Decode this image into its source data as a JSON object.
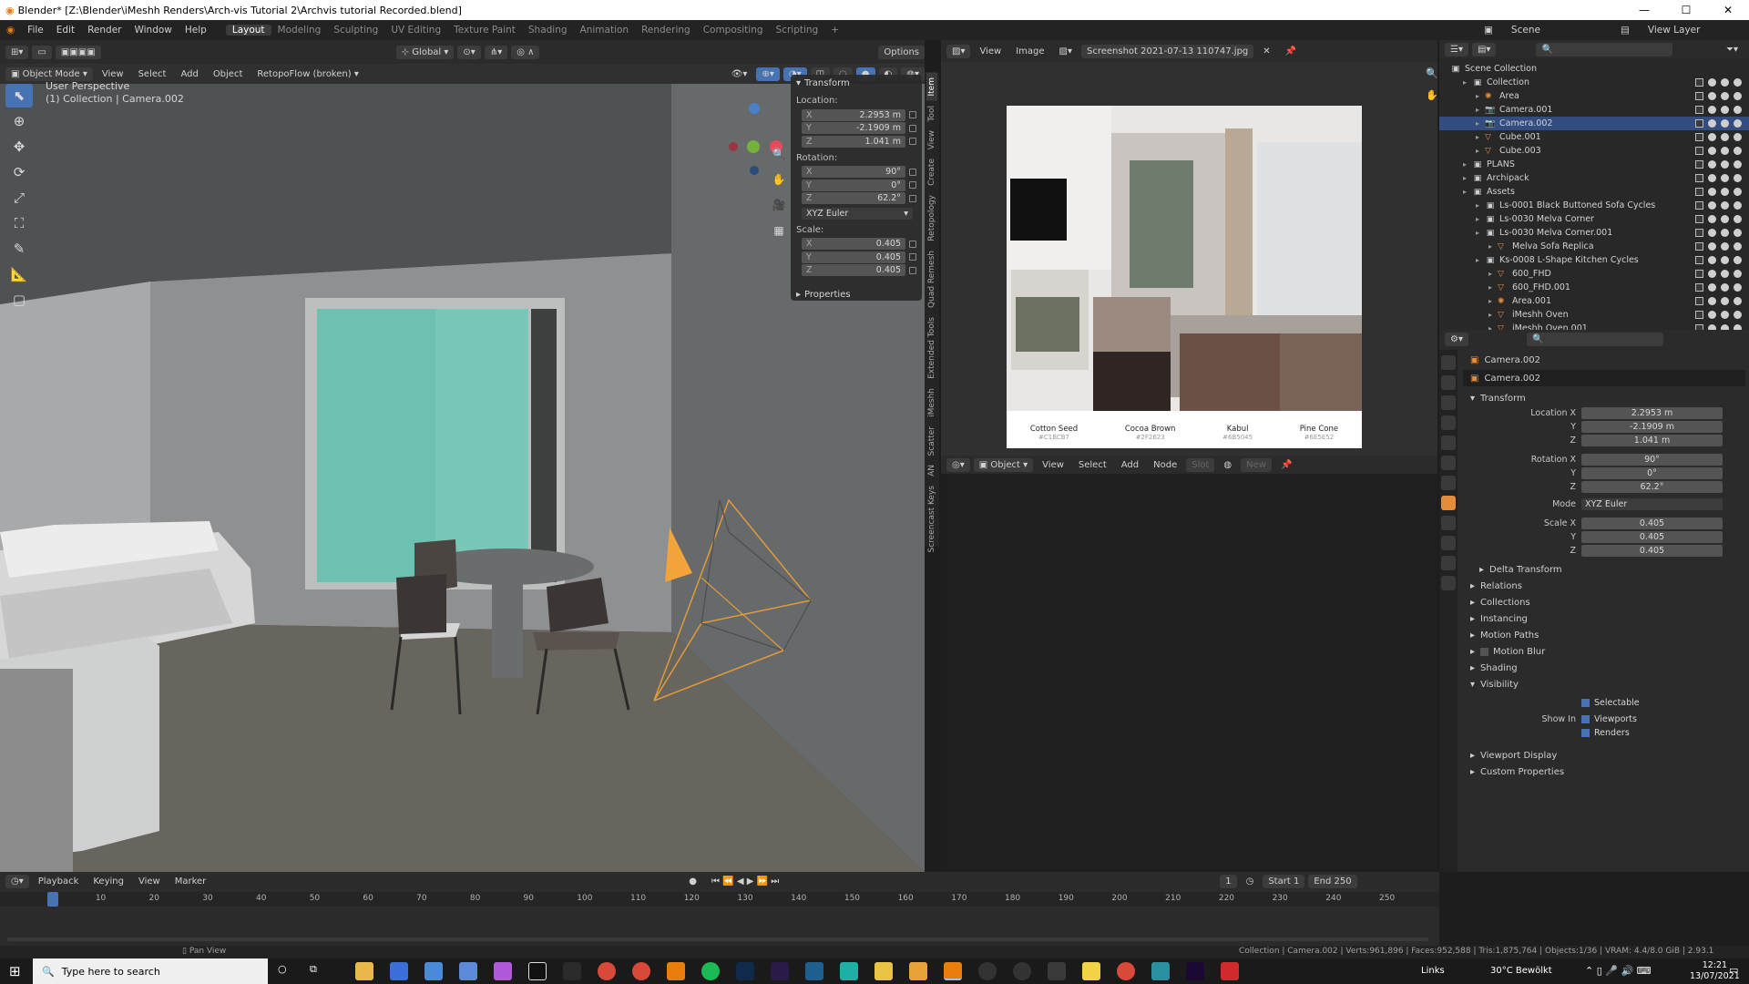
{
  "titlebar": {
    "title": "Blender* [Z:\\Blender\\iMeshh Renders\\Arch-vis Tutorial 2\\Archvis tutorial Recorded.blend]",
    "min": "—",
    "max": "☐",
    "close": "✕"
  },
  "menubar": {
    "menus": [
      "File",
      "Edit",
      "Render",
      "Window",
      "Help"
    ],
    "workspaces": [
      "Layout",
      "Modeling",
      "Sculpting",
      "UV Editing",
      "Texture Paint",
      "Shading",
      "Animation",
      "Rendering",
      "Compositing",
      "Scripting"
    ],
    "scene": "Scene",
    "view_layer": "View Layer"
  },
  "viewport": {
    "header": {
      "transform": "Global",
      "options": "Options"
    },
    "header2": {
      "mode": "Object Mode",
      "view": "View",
      "select": "Select",
      "add": "Add",
      "object": "Object",
      "addon": "RetopoFlow (broken)"
    },
    "info_line1": "User Perspective",
    "info_line2": "(1) Collection | Camera.002"
  },
  "npanel": {
    "transform_title": "Transform",
    "location_label": "Location:",
    "location": [
      {
        "axis": "X",
        "value": "2.2953 m"
      },
      {
        "axis": "Y",
        "value": "-2.1909 m"
      },
      {
        "axis": "Z",
        "value": "1.041 m"
      }
    ],
    "rotation_label": "Rotation:",
    "rotation": [
      {
        "axis": "X",
        "value": "90°"
      },
      {
        "axis": "Y",
        "value": "0°"
      },
      {
        "axis": "Z",
        "value": "62.2°"
      }
    ],
    "rotation_mode": "XYZ Euler",
    "scale_label": "Scale:",
    "scale": [
      {
        "axis": "X",
        "value": "0.405"
      },
      {
        "axis": "Y",
        "value": "0.405"
      },
      {
        "axis": "Z",
        "value": "0.405"
      }
    ],
    "properties_title": "Properties"
  },
  "sidetabs": [
    "Item",
    "Tool",
    "View",
    "Create",
    "Retopology",
    "Quad Remesh",
    "Extended Tools",
    "iMeshh",
    "Scatter",
    "AN",
    "Screencast Keys"
  ],
  "image_editor": {
    "view": "View",
    "image": "Image",
    "filename": "Screenshot 2021-07-13 110747.jpg",
    "swatches": [
      {
        "name": "Cotton Seed",
        "hex": "#C1BCB7",
        "color": "#c1bcb7"
      },
      {
        "name": "Cocoa Brown",
        "hex": "#2F2623",
        "color": "#2f2623"
      },
      {
        "name": "Kabul",
        "hex": "#6B5045",
        "color": "#6b5045"
      },
      {
        "name": "Pine Cone",
        "hex": "#6E5E52",
        "color": "#6e5e52"
      }
    ]
  },
  "node_editor": {
    "mode": "Object",
    "view": "View",
    "select": "Select",
    "add": "Add",
    "node": "Node",
    "slot": "Slot",
    "new": "New"
  },
  "outliner": {
    "title": "Scene Collection",
    "rows": [
      {
        "label": "Collection",
        "indent": 1,
        "icon": "collection",
        "sel": false
      },
      {
        "label": "Area",
        "indent": 2,
        "icon": "light",
        "sel": false
      },
      {
        "label": "Camera.001",
        "indent": 2,
        "icon": "camera",
        "sel": false
      },
      {
        "label": "Camera.002",
        "indent": 2,
        "icon": "camera",
        "sel": true
      },
      {
        "label": "Cube.001",
        "indent": 2,
        "icon": "mesh",
        "sel": false
      },
      {
        "label": "Cube.003",
        "indent": 2,
        "icon": "mesh",
        "sel": false
      },
      {
        "label": "PLANS",
        "indent": 1,
        "icon": "collection",
        "sel": false
      },
      {
        "label": "Archipack",
        "indent": 1,
        "icon": "collection",
        "sel": false
      },
      {
        "label": "Assets",
        "indent": 1,
        "icon": "collection",
        "sel": false
      },
      {
        "label": "Ls-0001 Black Buttoned Sofa Cycles",
        "indent": 2,
        "icon": "collection",
        "sel": false
      },
      {
        "label": "Ls-0030 Melva Corner",
        "indent": 2,
        "icon": "collection",
        "sel": false
      },
      {
        "label": "Ls-0030 Melva Corner.001",
        "indent": 2,
        "icon": "collection",
        "sel": false
      },
      {
        "label": "Melva Sofa Replica",
        "indent": 3,
        "icon": "mesh",
        "sel": false
      },
      {
        "label": "Ks-0008 L-Shape Kitchen Cycles",
        "indent": 2,
        "icon": "collection",
        "sel": false
      },
      {
        "label": "600_FHD",
        "indent": 3,
        "icon": "mesh",
        "sel": false
      },
      {
        "label": "600_FHD.001",
        "indent": 3,
        "icon": "mesh",
        "sel": false
      },
      {
        "label": "Area.001",
        "indent": 3,
        "icon": "light",
        "sel": false
      },
      {
        "label": "iMeshh Oven",
        "indent": 3,
        "icon": "mesh",
        "sel": false
      },
      {
        "label": "iMeshh Oven.001",
        "indent": 3,
        "icon": "mesh",
        "sel": false
      }
    ]
  },
  "properties": {
    "object_name": "Camera.002",
    "data_name": "Camera.002",
    "transform_title": "Transform",
    "location": [
      {
        "label": "Location X",
        "value": "2.2953 m"
      },
      {
        "label": "Y",
        "value": "-2.1909 m"
      },
      {
        "label": "Z",
        "value": "1.041 m"
      }
    ],
    "rotation": [
      {
        "label": "Rotation X",
        "value": "90°"
      },
      {
        "label": "Y",
        "value": "0°"
      },
      {
        "label": "Z",
        "value": "62.2°"
      }
    ],
    "mode_label": "Mode",
    "mode_value": "XYZ Euler",
    "scale": [
      {
        "label": "Scale X",
        "value": "0.405"
      },
      {
        "label": "Y",
        "value": "0.405"
      },
      {
        "label": "Z",
        "value": "0.405"
      }
    ],
    "delta_transform": "Delta Transform",
    "sections": [
      "Relations",
      "Collections",
      "Instancing",
      "Motion Paths",
      "Motion Blur",
      "Shading",
      "Visibility"
    ],
    "visibility": {
      "selectable": "Selectable",
      "show_in": "Show In",
      "viewports": "Viewports",
      "renders": "Renders"
    },
    "sections2": [
      "Viewport Display",
      "Custom Properties"
    ]
  },
  "timeline": {
    "menus": [
      "Playback",
      "Keying",
      "View",
      "Marker"
    ],
    "current_frame": "1",
    "start_label": "Start",
    "start": "1",
    "end_label": "End",
    "end": "250",
    "ticks": [
      "1",
      "10",
      "20",
      "30",
      "40",
      "50",
      "60",
      "70",
      "80",
      "90",
      "100",
      "110",
      "120",
      "130",
      "140",
      "150",
      "160",
      "170",
      "180",
      "190",
      "200",
      "210",
      "220",
      "230",
      "240",
      "250"
    ]
  },
  "statusbar": {
    "pan": "Pan View",
    "stats": "Collection | Camera.002 | Verts:961,896 | Faces:952,588 | Tris:1,875,764 | Objects:1/36 | VRAM: 4.4/8.0 GiB | 2.93.1"
  },
  "taskbar": {
    "search_placeholder": "Type here to search",
    "links": "Links",
    "weather": "30°C  Bewölkt",
    "time": "12:21",
    "date": "13/07/2021"
  }
}
